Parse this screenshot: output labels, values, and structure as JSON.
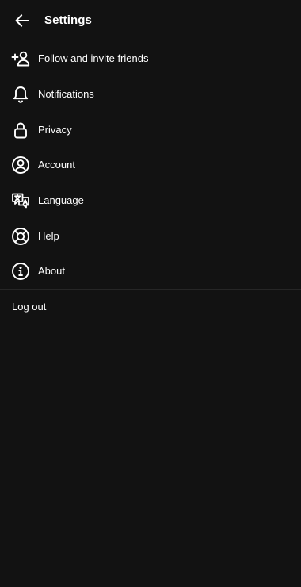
{
  "header": {
    "title": "Settings",
    "back_icon": "arrow-left-icon"
  },
  "menu": {
    "items": [
      {
        "label": "Follow and invite friends",
        "icon": "add-person-icon"
      },
      {
        "label": "Notifications",
        "icon": "bell-icon"
      },
      {
        "label": "Privacy",
        "icon": "lock-icon"
      },
      {
        "label": "Account",
        "icon": "user-circle-icon"
      },
      {
        "label": "Language",
        "icon": "translate-icon"
      },
      {
        "label": "Help",
        "icon": "lifebuoy-icon"
      },
      {
        "label": "About",
        "icon": "info-icon"
      }
    ]
  },
  "logout_label": "Log out",
  "colors": {
    "background": "#121212",
    "text": "#ffffff",
    "divider": "#262626"
  }
}
